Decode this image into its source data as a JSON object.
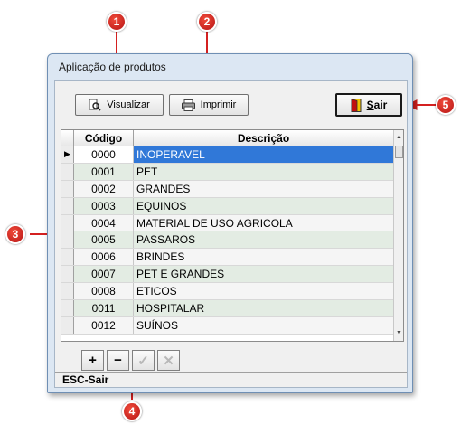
{
  "window": {
    "title": "Aplicação de produtos"
  },
  "toolbar": {
    "visualizar": {
      "mnemonic": "V",
      "rest": "isualizar",
      "icon": "magnifier-page-icon"
    },
    "imprimir": {
      "mnemonic": "I",
      "rest": "mprimir",
      "icon": "printer-icon"
    },
    "sair": {
      "mnemonic": "S",
      "rest": "air",
      "icon": "exit-door-icon"
    }
  },
  "grid": {
    "columns": [
      "Código",
      "Descrição"
    ],
    "current_row_marker": "▶",
    "rows": [
      {
        "codigo": "0000",
        "descricao": "INOPERAVEL"
      },
      {
        "codigo": "0001",
        "descricao": "PET"
      },
      {
        "codigo": "0002",
        "descricao": "GRANDES"
      },
      {
        "codigo": "0003",
        "descricao": "EQUINOS"
      },
      {
        "codigo": "0004",
        "descricao": "MATERIAL DE USO AGRICOLA"
      },
      {
        "codigo": "0005",
        "descricao": "PASSAROS"
      },
      {
        "codigo": "0006",
        "descricao": "BRINDES"
      },
      {
        "codigo": "0007",
        "descricao": "PET E GRANDES"
      },
      {
        "codigo": "0008",
        "descricao": "ETICOS"
      },
      {
        "codigo": "0011",
        "descricao": "HOSPITALAR"
      },
      {
        "codigo": "0012",
        "descricao": "SUÍNOS"
      }
    ]
  },
  "navigator": {
    "add": "+",
    "delete": "−",
    "post": "✓",
    "cancel": "✕"
  },
  "status_bar": {
    "text": "ESC-Sair"
  },
  "callouts": {
    "one": "1",
    "two": "2",
    "three": "3",
    "four": "4",
    "five": "5"
  },
  "colors": {
    "callout_red": "#d42020",
    "selection_blue": "#3078d8",
    "row_alt_green": "#e3ece3"
  }
}
